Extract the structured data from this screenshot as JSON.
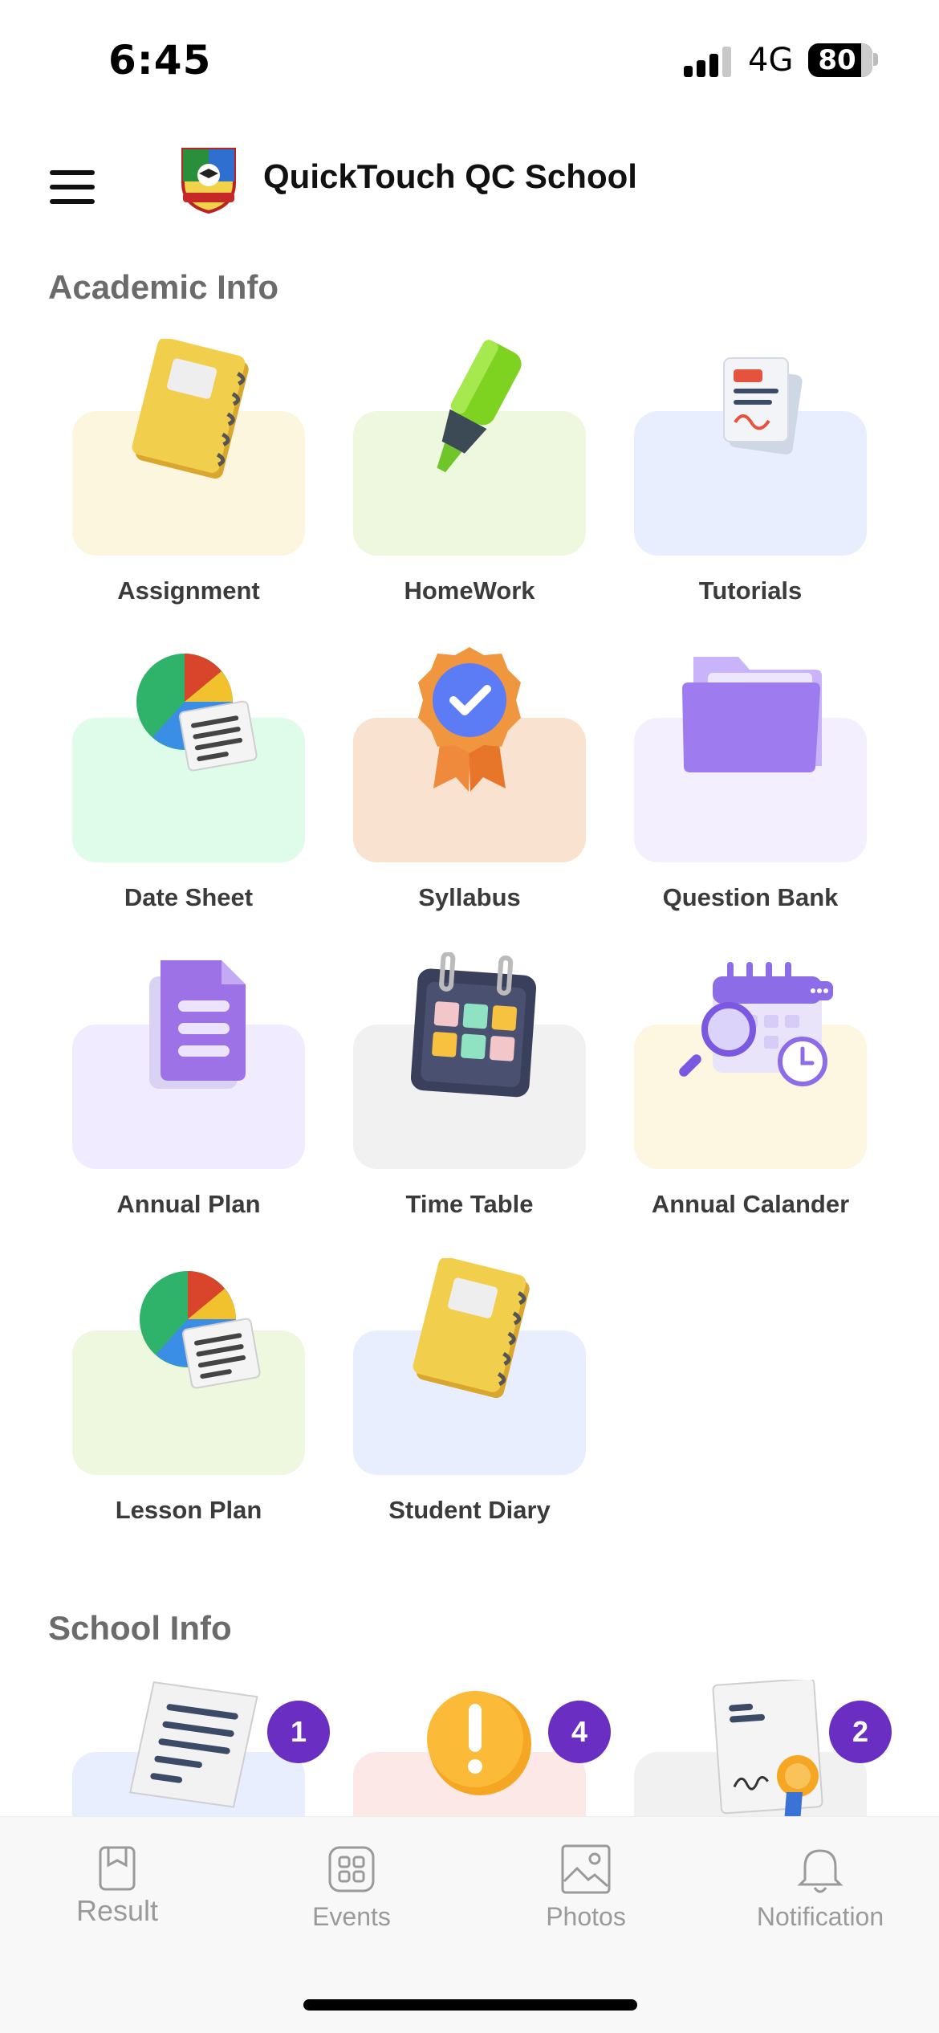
{
  "status_bar": {
    "time": "6:45",
    "network": "4G",
    "battery": "80"
  },
  "header": {
    "title": "QuickTouch QC School"
  },
  "academic": {
    "title": "Academic Info",
    "items": [
      {
        "label": "Assignment",
        "bg": "#fdf6df",
        "icon": "notebook-icon"
      },
      {
        "label": "HomeWork",
        "bg": "#eef8df",
        "icon": "highlighter-icon"
      },
      {
        "label": "Tutorials",
        "bg": "#e8eefd",
        "icon": "documents-icon"
      },
      {
        "label": "Date Sheet",
        "bg": "#dffbea",
        "icon": "pie-chart-report-icon"
      },
      {
        "label": "Syllabus",
        "bg": "#f9e2cf",
        "icon": "badge-check-icon"
      },
      {
        "label": "Question Bank",
        "bg": "#f4efff",
        "icon": "folder-icon"
      },
      {
        "label": "Annual Plan",
        "bg": "#f1ebff",
        "icon": "document-list-icon"
      },
      {
        "label": "Time Table",
        "bg": "#f1f1f1",
        "icon": "calendar-grid-icon"
      },
      {
        "label": "Annual Calander",
        "bg": "#fdf6e0",
        "icon": "calendar-search-icon"
      },
      {
        "label": "Lesson Plan",
        "bg": "#eef8df",
        "icon": "pie-chart-report-icon"
      },
      {
        "label": "Student Diary",
        "bg": "#e8eefd",
        "icon": "notebook-icon"
      }
    ]
  },
  "school": {
    "title": "School Info",
    "items": [
      {
        "badge": "1",
        "bg": "#e8eefd",
        "icon": "circular-document-icon"
      },
      {
        "badge": "4",
        "bg": "#fde8e8",
        "icon": "alert-icon"
      },
      {
        "badge": "2",
        "bg": "#f1f1f1",
        "icon": "certificate-icon"
      }
    ]
  },
  "bottom_nav": [
    {
      "label": "Result",
      "icon": "bookmark-icon"
    },
    {
      "label": "Events",
      "icon": "grid-icon"
    },
    {
      "label": "Photos",
      "icon": "image-icon"
    },
    {
      "label": "Notification",
      "icon": "bell-icon"
    }
  ]
}
